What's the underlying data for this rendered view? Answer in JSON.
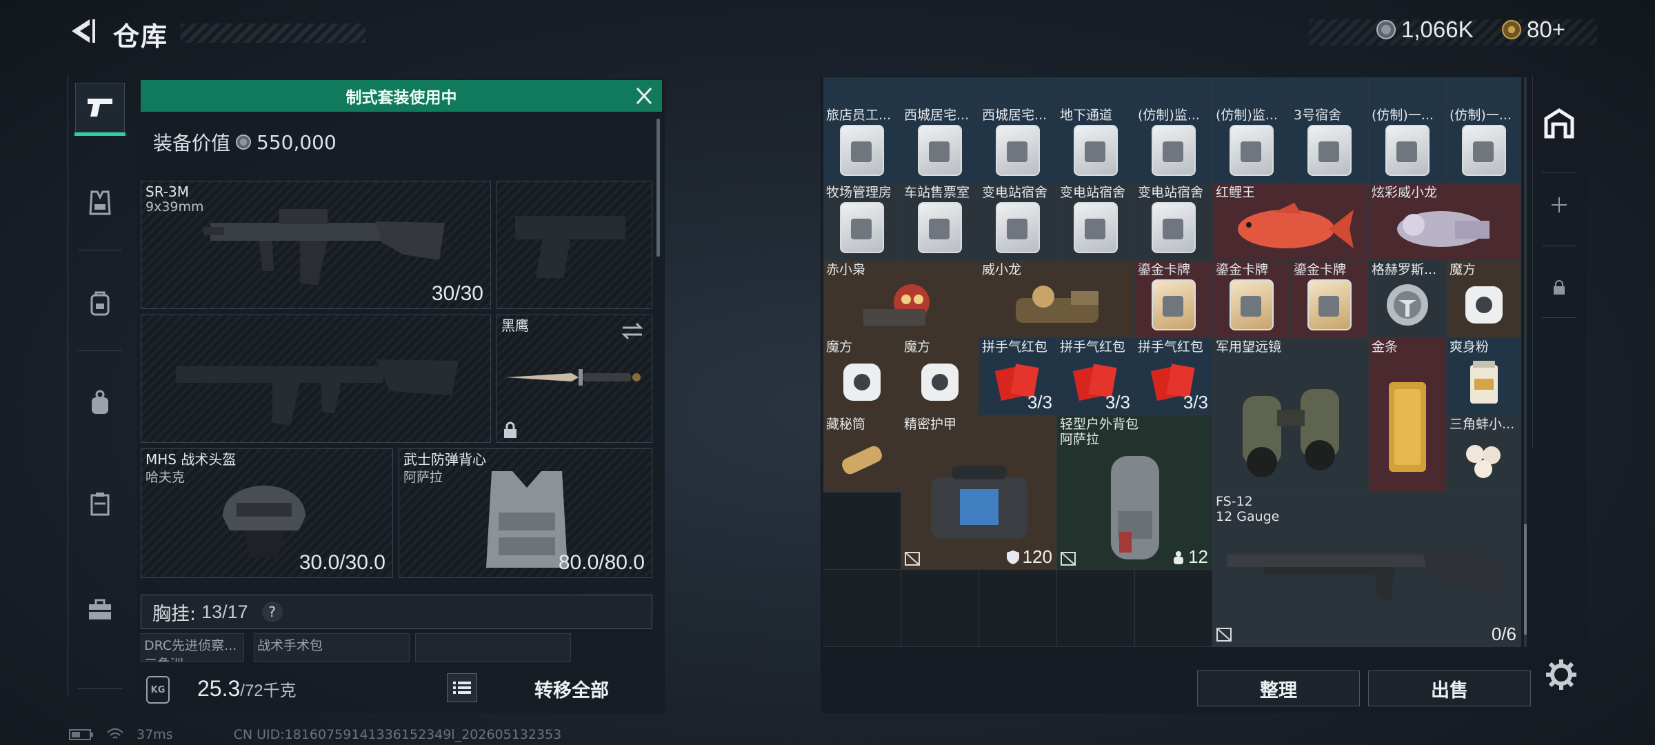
{
  "header": {
    "title": "仓库",
    "currency_1": "1,066K",
    "currency_2": "80+"
  },
  "nav": {
    "tabs": [
      "weapons",
      "vest",
      "backpack",
      "bag",
      "case",
      "toolbox"
    ]
  },
  "kit": {
    "banner": "制式套装使用中",
    "value_label": "装备价值",
    "value": "550,000"
  },
  "slots": {
    "primary": {
      "name": "SR-3M",
      "sub": "9x39mm",
      "ammo": "30/30"
    },
    "melee": {
      "name": "黑鹰"
    },
    "helmet": {
      "name": "MHS 战术头盔",
      "sub": "哈夫克",
      "durability": "30.0/30.0"
    },
    "armor": {
      "name": "武士防弹背心",
      "sub": "阿萨拉",
      "durability": "80.0/80.0"
    }
  },
  "rig": {
    "label": "胸挂:",
    "count": "13/17",
    "help": "?",
    "mini": [
      "DRC先进侦察...",
      "三角洲",
      "战术手术包"
    ]
  },
  "weight": {
    "current": "25.3",
    "max": "/72",
    "unit": "千克",
    "icon_text": "KG"
  },
  "transfer_all": "转移全部",
  "status": {
    "ping": "37ms",
    "uid": "CN UID:18160759141336152349l_202605132353"
  },
  "grid": {
    "row1_labels": [
      "旅店员工...",
      "西城居宅...",
      "西城居宅...",
      "地下通道",
      "(仿制)监...",
      "(仿制)监...",
      "3号宿舍",
      "(仿制)一...",
      "(仿制)一..."
    ],
    "row2_labels": [
      "牧场管理房",
      "车站售票室",
      "变电站宿舍",
      "变电站宿舍",
      "变电站宿舍"
    ],
    "koi": "红鲤王",
    "colorful": "炫彩威小龙",
    "row3_labels": [
      "赤小枭",
      "威小龙",
      "鎏金卡牌",
      "鎏金卡牌",
      "鎏金卡牌",
      "格赫罗斯...",
      "魔方"
    ],
    "row4_labels": [
      "魔方",
      "魔方",
      "拼手气红包",
      "拼手气红包",
      "拼手气红包"
    ],
    "redpack_count": "3/3",
    "binoculars": "军用望远镜",
    "gold_bar": "金条",
    "powder": "爽身粉",
    "row5_labels": [
      "藏秘筒",
      "精密护甲",
      "三角蚌小..."
    ],
    "backpack": {
      "name": "轻型户外背包",
      "sub": "阿萨拉",
      "count": "12"
    },
    "armor_count": "120",
    "shotgun": {
      "name": "FS-12",
      "sub": "12 Gauge",
      "count": "0/6"
    }
  },
  "buttons": {
    "sort": "整理",
    "sell": "出售"
  }
}
